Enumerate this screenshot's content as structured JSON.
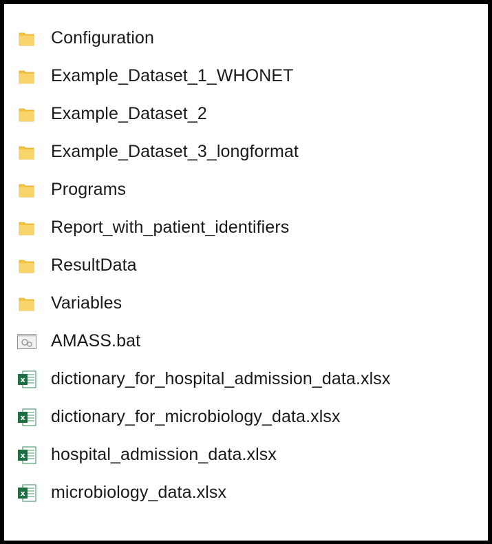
{
  "explorer": {
    "items": [
      {
        "name": "Configuration",
        "type": "folder",
        "icon": "folder-icon"
      },
      {
        "name": "Example_Dataset_1_WHONET",
        "type": "folder",
        "icon": "folder-icon"
      },
      {
        "name": "Example_Dataset_2",
        "type": "folder",
        "icon": "folder-icon"
      },
      {
        "name": "Example_Dataset_3_longformat",
        "type": "folder",
        "icon": "folder-icon"
      },
      {
        "name": "Programs",
        "type": "folder",
        "icon": "folder-icon"
      },
      {
        "name": "Report_with_patient_identifiers",
        "type": "folder",
        "icon": "folder-icon"
      },
      {
        "name": "ResultData",
        "type": "folder",
        "icon": "folder-icon"
      },
      {
        "name": "Variables",
        "type": "folder",
        "icon": "folder-icon"
      },
      {
        "name": "AMASS.bat",
        "type": "batch",
        "icon": "batch-file-icon"
      },
      {
        "name": "dictionary_for_hospital_admission_data.xlsx",
        "type": "excel",
        "icon": "excel-file-icon"
      },
      {
        "name": "dictionary_for_microbiology_data.xlsx",
        "type": "excel",
        "icon": "excel-file-icon"
      },
      {
        "name": "hospital_admission_data.xlsx",
        "type": "excel",
        "icon": "excel-file-icon"
      },
      {
        "name": "microbiology_data.xlsx",
        "type": "excel",
        "icon": "excel-file-icon"
      }
    ]
  },
  "colors": {
    "folder": "#f4c542",
    "excel_green": "#1d6f42",
    "text": "#1a1a1a",
    "border": "#000000"
  }
}
